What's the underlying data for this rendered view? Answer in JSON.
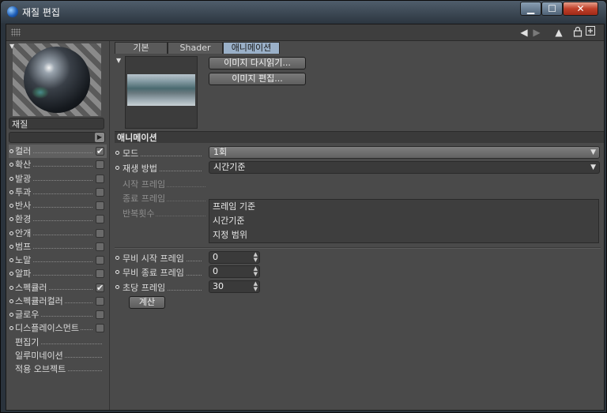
{
  "window": {
    "title": "재질 편집",
    "minimize_label": "▁",
    "maximize_label": "☐",
    "close_label": "✕"
  },
  "toolbar": {
    "icons": [
      "grip-icon",
      "back-arrow-icon",
      "forward-arrow-icon",
      "up-arrow-icon",
      "lock-icon",
      "new-window-icon"
    ]
  },
  "material": {
    "name": "재질"
  },
  "channels": [
    {
      "label": "컬러",
      "checked": true,
      "selected": true,
      "has_dot": true
    },
    {
      "label": "확산",
      "checked": false,
      "has_dot": true
    },
    {
      "label": "발광",
      "checked": false,
      "has_dot": true
    },
    {
      "label": "투과",
      "checked": false,
      "has_dot": true
    },
    {
      "label": "반사",
      "checked": false,
      "has_dot": true
    },
    {
      "label": "환경",
      "checked": false,
      "has_dot": true
    },
    {
      "label": "안개",
      "checked": false,
      "has_dot": true
    },
    {
      "label": "범프",
      "checked": false,
      "has_dot": true
    },
    {
      "label": "노말",
      "checked": false,
      "has_dot": true
    },
    {
      "label": "알파",
      "checked": false,
      "has_dot": true
    },
    {
      "label": "스펙큘러",
      "checked": true,
      "has_dot": true
    },
    {
      "label": "스펙큘러컬러",
      "checked": false,
      "has_dot": true
    },
    {
      "label": "글로우",
      "checked": false,
      "has_dot": true
    },
    {
      "label": "디스플레이스먼트",
      "checked": false,
      "has_dot": true
    },
    {
      "label": "편집기",
      "has_dot": false,
      "has_checkbox": false
    },
    {
      "label": "일루미네이션",
      "has_dot": false,
      "has_checkbox": false
    },
    {
      "label": "적용 오브젝트",
      "has_dot": false,
      "has_checkbox": false
    }
  ],
  "tabs": [
    {
      "label": "기본"
    },
    {
      "label": "Shader"
    },
    {
      "label": "애니메이션",
      "active": true
    }
  ],
  "texture": {
    "reload_button": "이미지 다시읽기...",
    "edit_button": "이미지 편집..."
  },
  "animation": {
    "section_title": "애니메이션",
    "mode_label": "모드",
    "mode_value": "1회",
    "playback_label": "재생 방법",
    "playback_value": "시간기준",
    "start_frame_label": "시작 프레임",
    "end_frame_label": "종료 프레임",
    "repeat_label": "반복횟수",
    "playback_options": [
      "프레임 기준",
      "시간기준",
      "지정 범위"
    ],
    "movie_start_label": "무비 시작 프레임",
    "movie_start_value": "0",
    "movie_end_label": "무비 종료 프레임",
    "movie_end_value": "0",
    "fps_label": "초당 프레임",
    "fps_value": "30",
    "calc_button": "계산"
  }
}
